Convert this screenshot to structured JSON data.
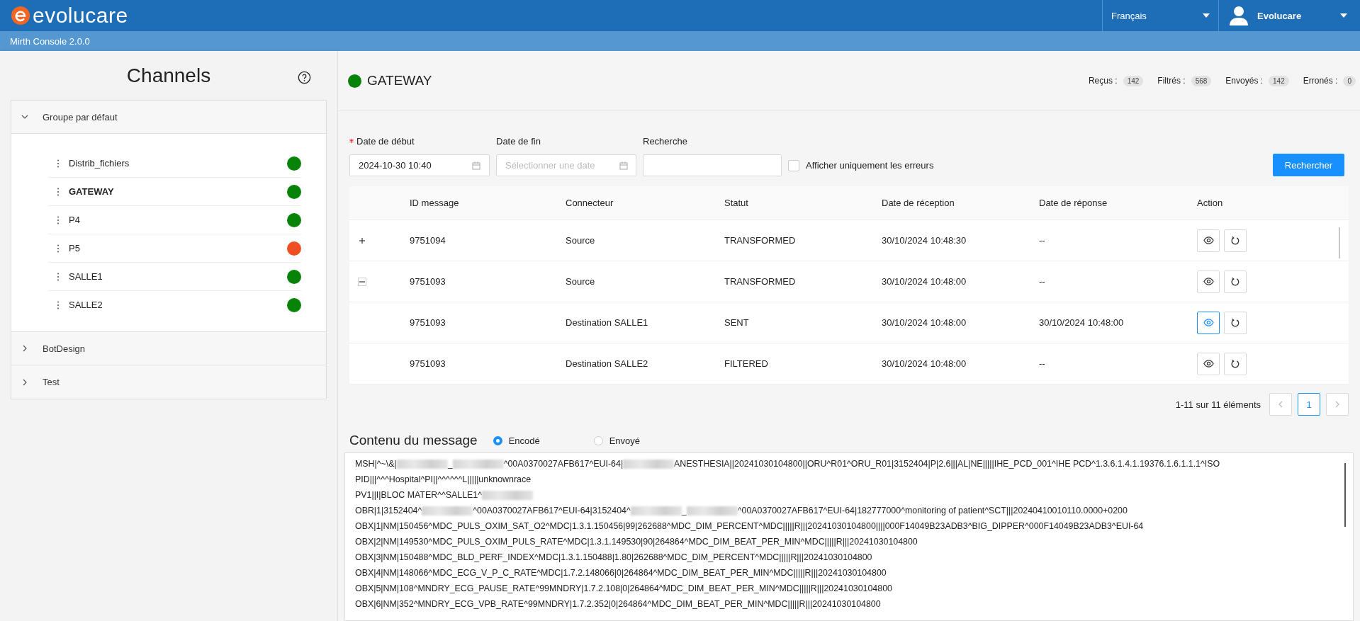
{
  "header": {
    "brand": "evolucare",
    "language": "Français",
    "user": "Evolucare"
  },
  "subheader": {
    "title": "Mirth Console 2.0.0"
  },
  "sidebar": {
    "title": "Channels",
    "groups": [
      {
        "name": "Groupe par défaut",
        "expanded": true,
        "channels": [
          {
            "name": "Distrib_fichiers",
            "selected": false,
            "color": "#078407"
          },
          {
            "name": "GATEWAY",
            "selected": true,
            "color": "#078407"
          },
          {
            "name": "P4",
            "selected": false,
            "color": "#078407"
          },
          {
            "name": "P5",
            "selected": false,
            "color": "#ef4d22"
          },
          {
            "name": "SALLE1",
            "selected": false,
            "color": "#078407"
          },
          {
            "name": "SALLE2",
            "selected": false,
            "color": "#078407"
          }
        ]
      },
      {
        "name": "BotDesign",
        "expanded": false
      },
      {
        "name": "Test",
        "expanded": false
      }
    ]
  },
  "channel": {
    "name": "GATEWAY",
    "color": "#078407",
    "stats": [
      {
        "label": "Reçus :",
        "count": "142"
      },
      {
        "label": "Filtrés :",
        "count": "568"
      },
      {
        "label": "Envoyés :",
        "count": "142"
      },
      {
        "label": "Erronés :",
        "count": "0"
      }
    ]
  },
  "filters": {
    "start_date": {
      "label": "Date de début",
      "required": true,
      "value": "2024-10-30 10:40"
    },
    "end_date": {
      "label": "Date de fin",
      "placeholder": "Sélectionner une date"
    },
    "search": {
      "label": "Recherche"
    },
    "errors_only": {
      "label": "Afficher uniquement les erreurs",
      "checked": false
    },
    "button": "Rechercher"
  },
  "table": {
    "columns": [
      "ID message",
      "Connecteur",
      "Statut",
      "Date de réception",
      "Date de réponse",
      "Action"
    ],
    "rows": [
      {
        "kind": "parent",
        "expanded": false,
        "cells": [
          "9751094",
          "Source",
          "TRANSFORMED",
          "30/10/2024 10:48:30",
          "--"
        ],
        "view_selected": false
      },
      {
        "kind": "parent",
        "expanded": true,
        "cells": [
          "9751093",
          "Source",
          "TRANSFORMED",
          "30/10/2024 10:48:00",
          "--"
        ],
        "view_selected": false
      },
      {
        "kind": "child",
        "cells": [
          "9751093",
          "Destination SALLE1",
          "SENT",
          "30/10/2024 10:48:00",
          "30/10/2024 10:48:00"
        ],
        "view_selected": true
      },
      {
        "kind": "child",
        "cells": [
          "9751093",
          "Destination SALLE2",
          "FILTERED",
          "30/10/2024 10:48:00",
          "--"
        ],
        "view_selected": false
      }
    ]
  },
  "pagination": {
    "range": "1-11 sur 11 éléments",
    "pages": [
      {
        "label": "1",
        "selected": true
      }
    ]
  },
  "message": {
    "title": "Contenu du message",
    "options": [
      {
        "label": "Encodé",
        "selected": true
      },
      {
        "label": "Envoyé",
        "selected": false
      }
    ],
    "lines": [
      [
        {
          "kind": "text",
          "text": "MSH|^~\\&|"
        },
        {
          "kind": "redacted"
        },
        {
          "kind": "text",
          "text": "_"
        },
        {
          "kind": "redacted"
        },
        {
          "kind": "text",
          "text": "^00A0370027AFB617^EUI-64|"
        },
        {
          "kind": "redacted"
        },
        {
          "kind": "text",
          "text": "ANESTHESIA||20241030104800||ORU^R01^ORU_R01|3152404|P|2.6|||AL|NE|||||IHE_PCD_001^IHE PCD^1.3.6.1.4.1.19376.1.6.1.1.1^ISO"
        }
      ],
      [
        {
          "kind": "text",
          "text": "PID|||^^^Hospital^PI||^^^^^^L|||||unknownrace"
        }
      ],
      [
        {
          "kind": "text",
          "text": "PV1||I|BLOC MATER^^SALLE1^"
        },
        {
          "kind": "redacted"
        }
      ],
      [
        {
          "kind": "text",
          "text": "OBR|1|3152404^"
        },
        {
          "kind": "redacted"
        },
        {
          "kind": "text",
          "text": "^00A0370027AFB617^EUI-64|3152404^"
        },
        {
          "kind": "redacted"
        },
        {
          "kind": "text",
          "text": "_"
        },
        {
          "kind": "redacted"
        },
        {
          "kind": "text",
          "text": "^00A0370027AFB617^EUI-64|182777000^monitoring of patient^SCT|||20240410010110.0000+0200"
        }
      ],
      [
        {
          "kind": "text",
          "text": "OBX|1|NM|150456^MDC_PULS_OXIM_SAT_O2^MDC|1.3.1.150456|99|262688^MDC_DIM_PERCENT^MDC|||||R|||20241030104800||||000F14049B23ADB3^BIG_DIPPER^000F14049B23ADB3^EUI-64"
        }
      ],
      [
        {
          "kind": "text",
          "text": "OBX|2|NM|149530^MDC_PULS_OXIM_PULS_RATE^MDC|1.3.1.149530|90|264864^MDC_DIM_BEAT_PER_MIN^MDC|||||R|||20241030104800"
        }
      ],
      [
        {
          "kind": "text",
          "text": "OBX|3|NM|150488^MDC_BLD_PERF_INDEX^MDC|1.3.1.150488|1.80|262688^MDC_DIM_PERCENT^MDC|||||R|||20241030104800"
        }
      ],
      [
        {
          "kind": "text",
          "text": "OBX|4|NM|148066^MDC_ECG_V_P_C_RATE^MDC|1.7.2.148066|0|264864^MDC_DIM_BEAT_PER_MIN^MDC|||||R|||20241030104800"
        }
      ],
      [
        {
          "kind": "text",
          "text": "OBX|5|NM|108^MNDRY_ECG_PAUSE_RATE^99MNDRY|1.7.2.108|0|264864^MDC_DIM_BEAT_PER_MIN^MDC|||||R|||20241030104800"
        }
      ],
      [
        {
          "kind": "text",
          "text": "OBX|6|NM|352^MNDRY_ECG_VPB_RATE^99MNDRY|1.7.2.352|0|264864^MDC_DIM_BEAT_PER_MIN^MDC|||||R|||20241030104800"
        }
      ]
    ]
  }
}
